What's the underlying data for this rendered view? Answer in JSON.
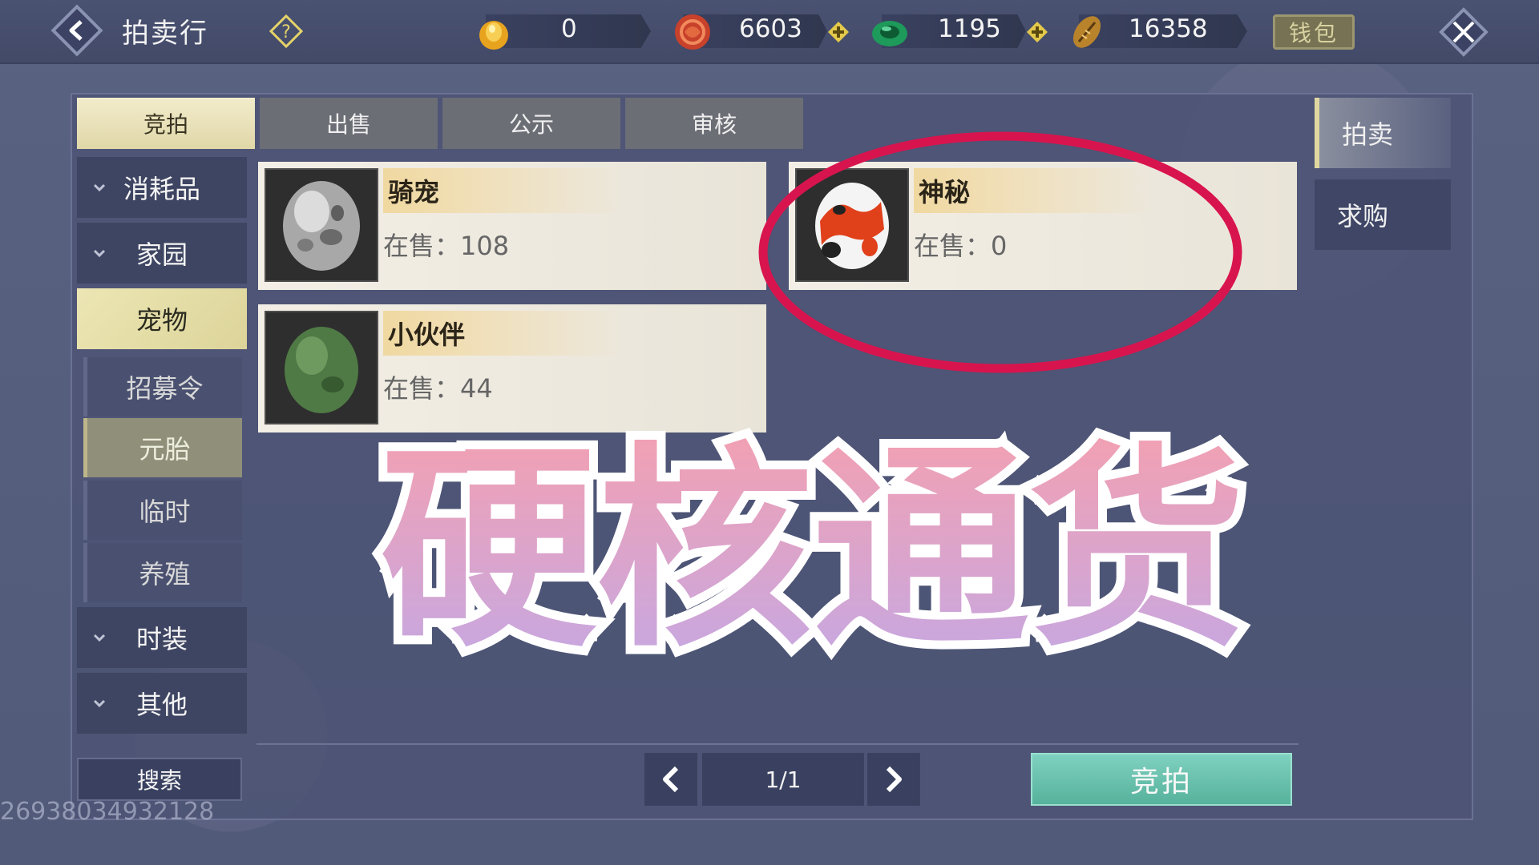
{
  "header": {
    "title": "拍卖行",
    "currencies": [
      {
        "icon": "gold-ingot-icon",
        "value": "0"
      },
      {
        "icon": "red-coin-icon",
        "value": "6603"
      },
      {
        "icon": "jade-coin-icon",
        "value": "1195"
      },
      {
        "icon": "bronze-shell-icon",
        "value": "16358"
      }
    ],
    "wallet_label": "钱包"
  },
  "tabs": [
    {
      "label": "竞拍",
      "active": true
    },
    {
      "label": "出售",
      "active": false
    },
    {
      "label": "公示",
      "active": false
    },
    {
      "label": "审核",
      "active": false
    }
  ],
  "categories": {
    "consumables": "消耗品",
    "home": "家园",
    "pets": "宠物",
    "pet_sub": [
      "招募令",
      "元胎",
      "临时",
      "养殖"
    ],
    "fashion": "时装",
    "other": "其他"
  },
  "items": [
    {
      "name": "骑宠",
      "sale_label": "在售：",
      "count": "108"
    },
    {
      "name": "神秘",
      "sale_label": "在售：",
      "count": "0"
    },
    {
      "name": "小伙伴",
      "sale_label": "在售：",
      "count": "44"
    }
  ],
  "right_tabs": [
    "拍卖",
    "求购"
  ],
  "footer": {
    "search_label": "搜索",
    "page_indicator": "1/1",
    "bid_label": "竞拍",
    "user_id": "26938034932128"
  },
  "overlay": {
    "caption": "硬核通货"
  },
  "colors": {
    "accent_active": "#e8e0b0",
    "bid_button": "#66c2ad",
    "annotation": "#d8144e"
  }
}
